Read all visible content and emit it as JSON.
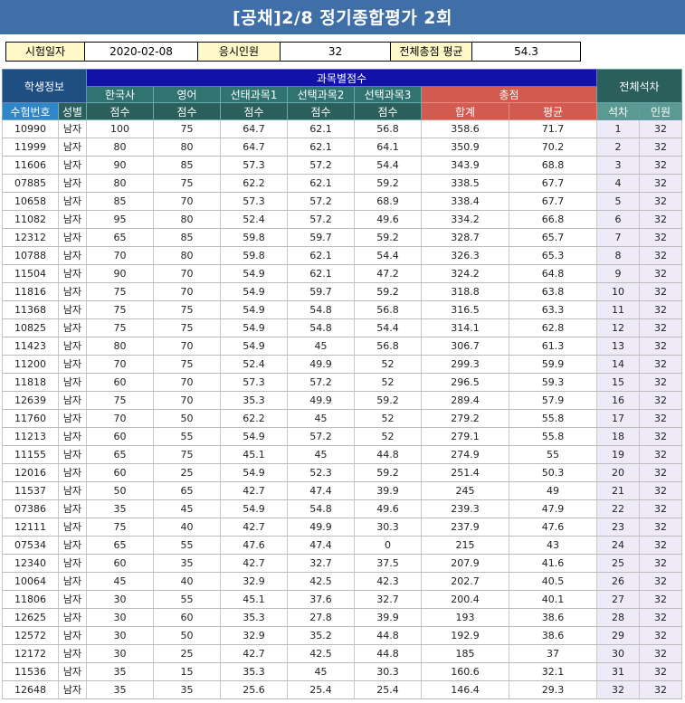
{
  "title": "[공채]2/8 정기종합평가 2회",
  "info": {
    "exam_date_label": "시험일자",
    "exam_date": "2020-02-08",
    "examinees_label": "응시인원",
    "examinees": "32",
    "avg_label": "전체총점 평균",
    "avg": "54.3"
  },
  "headers": {
    "student_info": "학생정보",
    "subject_scores": "과목별점수",
    "overall_rank": "전체석차",
    "history": "한국사",
    "english": "영어",
    "elective1": "선태과목1",
    "elective2": "선택과목2",
    "elective3": "선택과목3",
    "total": "총점",
    "exam_no": "수험번호",
    "gender": "성별",
    "score": "점수",
    "sum": "합계",
    "mean": "평균",
    "rank": "석차",
    "count": "인원"
  },
  "rows": [
    [
      "10990",
      "남자",
      "100",
      "75",
      "64.7",
      "62.1",
      "56.8",
      "358.6",
      "71.7",
      "1",
      "32"
    ],
    [
      "11999",
      "남자",
      "80",
      "80",
      "64.7",
      "62.1",
      "64.1",
      "350.9",
      "70.2",
      "2",
      "32"
    ],
    [
      "11606",
      "남자",
      "90",
      "85",
      "57.3",
      "57.2",
      "54.4",
      "343.9",
      "68.8",
      "3",
      "32"
    ],
    [
      "07885",
      "남자",
      "80",
      "75",
      "62.2",
      "62.1",
      "59.2",
      "338.5",
      "67.7",
      "4",
      "32"
    ],
    [
      "10658",
      "남자",
      "85",
      "70",
      "57.3",
      "57.2",
      "68.9",
      "338.4",
      "67.7",
      "5",
      "32"
    ],
    [
      "11082",
      "남자",
      "95",
      "80",
      "52.4",
      "57.2",
      "49.6",
      "334.2",
      "66.8",
      "6",
      "32"
    ],
    [
      "12312",
      "남자",
      "65",
      "85",
      "59.8",
      "59.7",
      "59.2",
      "328.7",
      "65.7",
      "7",
      "32"
    ],
    [
      "10788",
      "남자",
      "70",
      "80",
      "59.8",
      "62.1",
      "54.4",
      "326.3",
      "65.3",
      "8",
      "32"
    ],
    [
      "11504",
      "남자",
      "90",
      "70",
      "54.9",
      "62.1",
      "47.2",
      "324.2",
      "64.8",
      "9",
      "32"
    ],
    [
      "11816",
      "남자",
      "75",
      "70",
      "54.9",
      "59.7",
      "59.2",
      "318.8",
      "63.8",
      "10",
      "32"
    ],
    [
      "11368",
      "남자",
      "75",
      "75",
      "54.9",
      "54.8",
      "56.8",
      "316.5",
      "63.3",
      "11",
      "32"
    ],
    [
      "10825",
      "남자",
      "75",
      "75",
      "54.9",
      "54.8",
      "54.4",
      "314.1",
      "62.8",
      "12",
      "32"
    ],
    [
      "11423",
      "남자",
      "80",
      "70",
      "54.9",
      "45",
      "56.8",
      "306.7",
      "61.3",
      "13",
      "32"
    ],
    [
      "11200",
      "남자",
      "70",
      "75",
      "52.4",
      "49.9",
      "52",
      "299.3",
      "59.9",
      "14",
      "32"
    ],
    [
      "11818",
      "남자",
      "60",
      "70",
      "57.3",
      "57.2",
      "52",
      "296.5",
      "59.3",
      "15",
      "32"
    ],
    [
      "12639",
      "남자",
      "75",
      "70",
      "35.3",
      "49.9",
      "59.2",
      "289.4",
      "57.9",
      "16",
      "32"
    ],
    [
      "11760",
      "남자",
      "70",
      "50",
      "62.2",
      "45",
      "52",
      "279.2",
      "55.8",
      "17",
      "32"
    ],
    [
      "11213",
      "남자",
      "60",
      "55",
      "54.9",
      "57.2",
      "52",
      "279.1",
      "55.8",
      "18",
      "32"
    ],
    [
      "11155",
      "남자",
      "65",
      "75",
      "45.1",
      "45",
      "44.8",
      "274.9",
      "55",
      "19",
      "32"
    ],
    [
      "12016",
      "남자",
      "60",
      "25",
      "54.9",
      "52.3",
      "59.2",
      "251.4",
      "50.3",
      "20",
      "32"
    ],
    [
      "11537",
      "남자",
      "50",
      "65",
      "42.7",
      "47.4",
      "39.9",
      "245",
      "49",
      "21",
      "32"
    ],
    [
      "07386",
      "남자",
      "35",
      "45",
      "54.9",
      "54.8",
      "49.6",
      "239.3",
      "47.9",
      "22",
      "32"
    ],
    [
      "12111",
      "남자",
      "75",
      "40",
      "42.7",
      "49.9",
      "30.3",
      "237.9",
      "47.6",
      "23",
      "32"
    ],
    [
      "07534",
      "남자",
      "65",
      "55",
      "47.6",
      "47.4",
      "0",
      "215",
      "43",
      "24",
      "32"
    ],
    [
      "12340",
      "남자",
      "60",
      "35",
      "42.7",
      "32.7",
      "37.5",
      "207.9",
      "41.6",
      "25",
      "32"
    ],
    [
      "10064",
      "남자",
      "45",
      "40",
      "32.9",
      "42.5",
      "42.3",
      "202.7",
      "40.5",
      "26",
      "32"
    ],
    [
      "11806",
      "남자",
      "30",
      "55",
      "45.1",
      "37.6",
      "32.7",
      "200.4",
      "40.1",
      "27",
      "32"
    ],
    [
      "12625",
      "남자",
      "30",
      "60",
      "35.3",
      "27.8",
      "39.9",
      "193",
      "38.6",
      "28",
      "32"
    ],
    [
      "12572",
      "남자",
      "30",
      "50",
      "32.9",
      "35.2",
      "44.8",
      "192.9",
      "38.6",
      "29",
      "32"
    ],
    [
      "12172",
      "남자",
      "30",
      "25",
      "42.7",
      "42.5",
      "44.8",
      "185",
      "37",
      "30",
      "32"
    ],
    [
      "11536",
      "남자",
      "35",
      "15",
      "35.3",
      "45",
      "30.3",
      "160.6",
      "32.1",
      "31",
      "32"
    ],
    [
      "12648",
      "남자",
      "35",
      "35",
      "25.6",
      "25.4",
      "25.4",
      "146.4",
      "29.3",
      "32",
      "32"
    ]
  ]
}
